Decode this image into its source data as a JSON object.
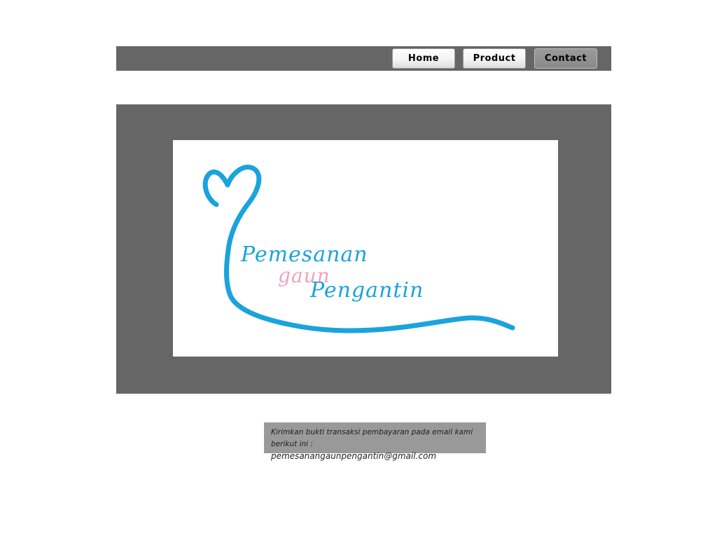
{
  "nav": {
    "items": [
      {
        "label": "Home"
      },
      {
        "label": "Product"
      },
      {
        "label": "Contact"
      }
    ],
    "active": "Contact"
  },
  "logo": {
    "line1": "Pemesanan",
    "line2": "gaun",
    "line3": "Pengantin",
    "colors": {
      "ribbon": "#1aa3dc",
      "accent": "#f0a3c0"
    }
  },
  "info": {
    "text_line1": "Kirimkan bukti transaksi pembayaran pada email kami",
    "text_line2": "berikut ini :",
    "email": "pemesanangaunpengantin@gmail.com"
  },
  "colors": {
    "bar": "#666666",
    "info_bg": "#999999"
  }
}
